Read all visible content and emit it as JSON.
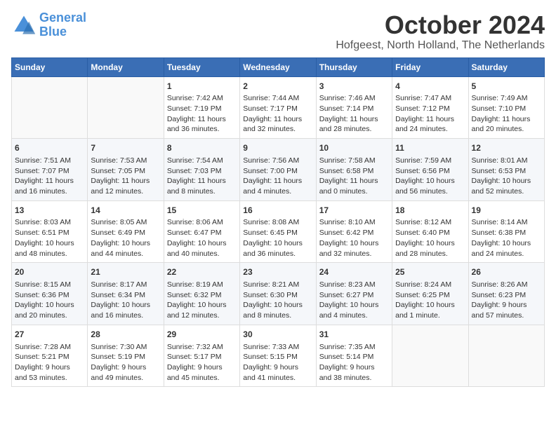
{
  "logo": {
    "line1": "General",
    "line2": "Blue"
  },
  "title": "October 2024",
  "location": "Hofgeest, North Holland, The Netherlands",
  "weekdays": [
    "Sunday",
    "Monday",
    "Tuesday",
    "Wednesday",
    "Thursday",
    "Friday",
    "Saturday"
  ],
  "weeks": [
    [
      {
        "day": "",
        "info": ""
      },
      {
        "day": "",
        "info": ""
      },
      {
        "day": "1",
        "info": "Sunrise: 7:42 AM\nSunset: 7:19 PM\nDaylight: 11 hours\nand 36 minutes."
      },
      {
        "day": "2",
        "info": "Sunrise: 7:44 AM\nSunset: 7:17 PM\nDaylight: 11 hours\nand 32 minutes."
      },
      {
        "day": "3",
        "info": "Sunrise: 7:46 AM\nSunset: 7:14 PM\nDaylight: 11 hours\nand 28 minutes."
      },
      {
        "day": "4",
        "info": "Sunrise: 7:47 AM\nSunset: 7:12 PM\nDaylight: 11 hours\nand 24 minutes."
      },
      {
        "day": "5",
        "info": "Sunrise: 7:49 AM\nSunset: 7:10 PM\nDaylight: 11 hours\nand 20 minutes."
      }
    ],
    [
      {
        "day": "6",
        "info": "Sunrise: 7:51 AM\nSunset: 7:07 PM\nDaylight: 11 hours\nand 16 minutes."
      },
      {
        "day": "7",
        "info": "Sunrise: 7:53 AM\nSunset: 7:05 PM\nDaylight: 11 hours\nand 12 minutes."
      },
      {
        "day": "8",
        "info": "Sunrise: 7:54 AM\nSunset: 7:03 PM\nDaylight: 11 hours\nand 8 minutes."
      },
      {
        "day": "9",
        "info": "Sunrise: 7:56 AM\nSunset: 7:00 PM\nDaylight: 11 hours\nand 4 minutes."
      },
      {
        "day": "10",
        "info": "Sunrise: 7:58 AM\nSunset: 6:58 PM\nDaylight: 11 hours\nand 0 minutes."
      },
      {
        "day": "11",
        "info": "Sunrise: 7:59 AM\nSunset: 6:56 PM\nDaylight: 10 hours\nand 56 minutes."
      },
      {
        "day": "12",
        "info": "Sunrise: 8:01 AM\nSunset: 6:53 PM\nDaylight: 10 hours\nand 52 minutes."
      }
    ],
    [
      {
        "day": "13",
        "info": "Sunrise: 8:03 AM\nSunset: 6:51 PM\nDaylight: 10 hours\nand 48 minutes."
      },
      {
        "day": "14",
        "info": "Sunrise: 8:05 AM\nSunset: 6:49 PM\nDaylight: 10 hours\nand 44 minutes."
      },
      {
        "day": "15",
        "info": "Sunrise: 8:06 AM\nSunset: 6:47 PM\nDaylight: 10 hours\nand 40 minutes."
      },
      {
        "day": "16",
        "info": "Sunrise: 8:08 AM\nSunset: 6:45 PM\nDaylight: 10 hours\nand 36 minutes."
      },
      {
        "day": "17",
        "info": "Sunrise: 8:10 AM\nSunset: 6:42 PM\nDaylight: 10 hours\nand 32 minutes."
      },
      {
        "day": "18",
        "info": "Sunrise: 8:12 AM\nSunset: 6:40 PM\nDaylight: 10 hours\nand 28 minutes."
      },
      {
        "day": "19",
        "info": "Sunrise: 8:14 AM\nSunset: 6:38 PM\nDaylight: 10 hours\nand 24 minutes."
      }
    ],
    [
      {
        "day": "20",
        "info": "Sunrise: 8:15 AM\nSunset: 6:36 PM\nDaylight: 10 hours\nand 20 minutes."
      },
      {
        "day": "21",
        "info": "Sunrise: 8:17 AM\nSunset: 6:34 PM\nDaylight: 10 hours\nand 16 minutes."
      },
      {
        "day": "22",
        "info": "Sunrise: 8:19 AM\nSunset: 6:32 PM\nDaylight: 10 hours\nand 12 minutes."
      },
      {
        "day": "23",
        "info": "Sunrise: 8:21 AM\nSunset: 6:30 PM\nDaylight: 10 hours\nand 8 minutes."
      },
      {
        "day": "24",
        "info": "Sunrise: 8:23 AM\nSunset: 6:27 PM\nDaylight: 10 hours\nand 4 minutes."
      },
      {
        "day": "25",
        "info": "Sunrise: 8:24 AM\nSunset: 6:25 PM\nDaylight: 10 hours\nand 1 minute."
      },
      {
        "day": "26",
        "info": "Sunrise: 8:26 AM\nSunset: 6:23 PM\nDaylight: 9 hours\nand 57 minutes."
      }
    ],
    [
      {
        "day": "27",
        "info": "Sunrise: 7:28 AM\nSunset: 5:21 PM\nDaylight: 9 hours\nand 53 minutes."
      },
      {
        "day": "28",
        "info": "Sunrise: 7:30 AM\nSunset: 5:19 PM\nDaylight: 9 hours\nand 49 minutes."
      },
      {
        "day": "29",
        "info": "Sunrise: 7:32 AM\nSunset: 5:17 PM\nDaylight: 9 hours\nand 45 minutes."
      },
      {
        "day": "30",
        "info": "Sunrise: 7:33 AM\nSunset: 5:15 PM\nDaylight: 9 hours\nand 41 minutes."
      },
      {
        "day": "31",
        "info": "Sunrise: 7:35 AM\nSunset: 5:14 PM\nDaylight: 9 hours\nand 38 minutes."
      },
      {
        "day": "",
        "info": ""
      },
      {
        "day": "",
        "info": ""
      }
    ]
  ]
}
